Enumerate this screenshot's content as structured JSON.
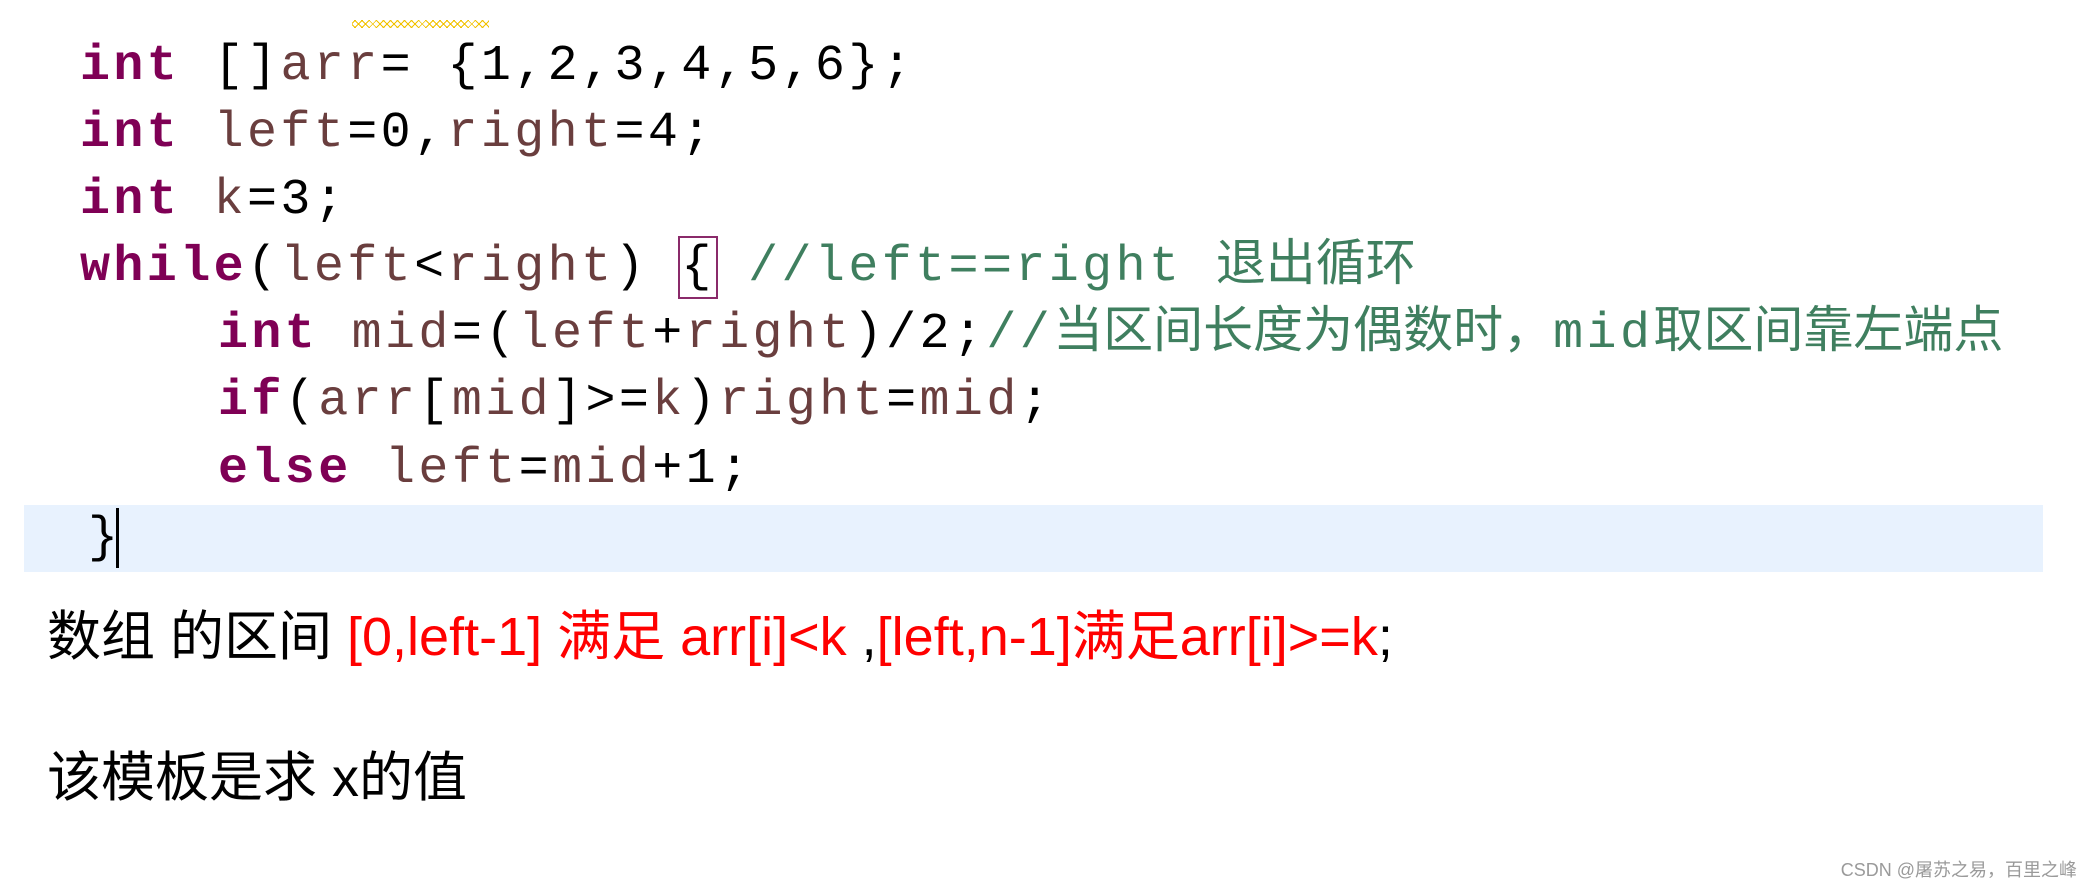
{
  "code": {
    "lines": [
      {
        "indent": 0,
        "tokens": [
          [
            "int",
            "kw"
          ],
          [
            " ",
            "pun"
          ],
          [
            "[]",
            "pun"
          ],
          [
            "arr",
            "var"
          ],
          [
            "= {1,2,3,4,5,6};",
            "pun"
          ]
        ]
      },
      {
        "indent": 0,
        "tokens": [
          [
            "int",
            "kw"
          ],
          [
            " ",
            "pun"
          ],
          [
            "left",
            "var"
          ],
          [
            "=0,",
            "pun"
          ],
          [
            "right",
            "var"
          ],
          [
            "=4;",
            "pun"
          ]
        ]
      },
      {
        "indent": 0,
        "tokens": [
          [
            "int",
            "kw"
          ],
          [
            " ",
            "pun"
          ],
          [
            "k",
            "var"
          ],
          [
            "=3;",
            "pun"
          ]
        ]
      },
      {
        "indent": 0,
        "tokens": [
          [
            "while",
            "kw"
          ],
          [
            "(",
            "pun"
          ],
          [
            "left",
            "var"
          ],
          [
            "<",
            "pun"
          ],
          [
            "right",
            "var"
          ],
          [
            ") ",
            "pun"
          ],
          [
            "{",
            "pun brace-box"
          ],
          [
            " //left==right ",
            "cmt"
          ],
          [
            "退出循环",
            "cmt cjk"
          ]
        ]
      },
      {
        "indent": 1,
        "tokens": [
          [
            "int",
            "kw"
          ],
          [
            " ",
            "pun"
          ],
          [
            "mid",
            "var"
          ],
          [
            "=(",
            "pun"
          ],
          [
            "left",
            "var"
          ],
          [
            "+",
            "pun"
          ],
          [
            "right",
            "var"
          ],
          [
            ")/2;",
            "pun"
          ],
          [
            "//",
            "cmt"
          ],
          [
            "当区间长度为偶数时，",
            "cmt cjk"
          ],
          [
            "mid",
            "cmt"
          ],
          [
            "取区间靠左端点",
            "cmt cjk"
          ]
        ]
      },
      {
        "indent": 1,
        "tokens": [
          [
            "if",
            "kw"
          ],
          [
            "(",
            "pun"
          ],
          [
            "arr",
            "var"
          ],
          [
            "[",
            "pun"
          ],
          [
            "mid",
            "var"
          ],
          [
            "]>=",
            "pun"
          ],
          [
            "k",
            "var"
          ],
          [
            ")",
            "pun"
          ],
          [
            "right",
            "var"
          ],
          [
            "=",
            "pun"
          ],
          [
            "mid",
            "var"
          ],
          [
            ";",
            "pun"
          ]
        ]
      },
      {
        "indent": 1,
        "tokens": [
          [
            "else",
            "kw"
          ],
          [
            " ",
            "pun"
          ],
          [
            "left",
            "var"
          ],
          [
            "=",
            "pun"
          ],
          [
            "mid",
            "var"
          ],
          [
            "+1;",
            "pun"
          ]
        ]
      },
      {
        "indent": 0,
        "tokens": [
          [
            "}",
            "pun"
          ]
        ]
      }
    ]
  },
  "notes": {
    "line1": {
      "prefix": "数组 的区间 ",
      "red1": "[0,left-1] 满足 arr[i]<k",
      "mid": " ,",
      "red2": "[left,n-1]满足arr[i]>=k",
      "suffix": ";"
    },
    "line2": "该模板是求 x的值"
  },
  "watermark": "CSDN @屠苏之易，百里之峰",
  "colors": {
    "keyword": "#7f0055",
    "variable": "#6a3e3e",
    "comment": "#3f7f5f",
    "highlight": "#e8f2fe",
    "note_red": "#ff0000"
  }
}
